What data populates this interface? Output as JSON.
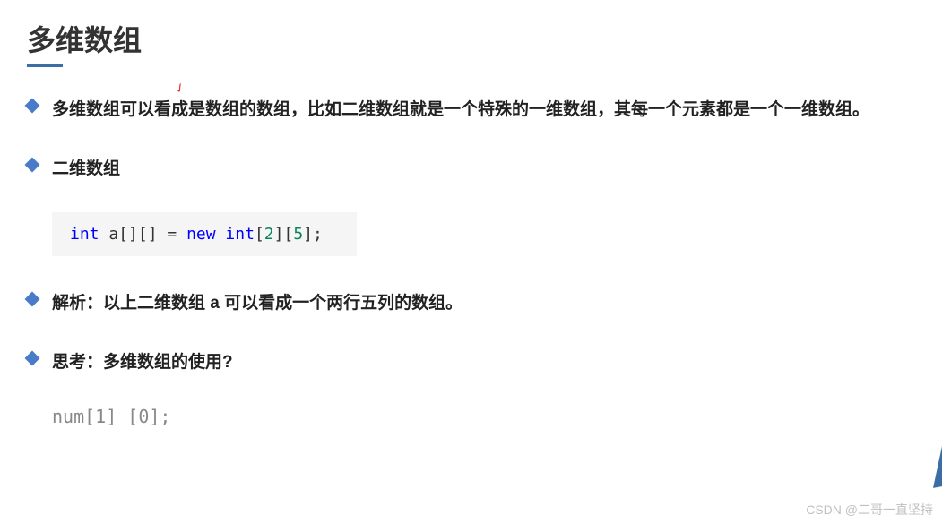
{
  "title": "多维数组",
  "bullets": {
    "b1": "多维数组可以看成是数组的数组，比如二维数组就是一个特殊的一维数组，其每一个元素都是一个一维数组。",
    "b2": "二维数组",
    "b3": "解析：以上二维数组 a 可以看成一个两行五列的数组。",
    "b4": "思考：多维数组的使用?"
  },
  "code": {
    "kw_int": "int",
    "ident": " a[][] ",
    "eq": "= ",
    "kw_new": "new",
    "sp": " ",
    "type_int": "int",
    "lb1": "[",
    "n1": "2",
    "rb1": "]",
    "lb2": "[",
    "n2": "5",
    "rb2": "]",
    "semi": ";"
  },
  "plain_code": "num[1] [0];",
  "watermark": "CSDN @二哥一直坚持",
  "cursor": "✓"
}
